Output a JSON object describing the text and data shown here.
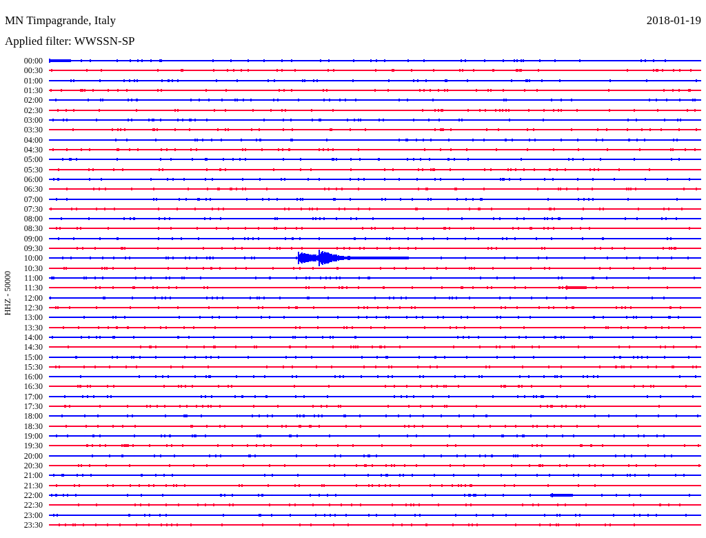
{
  "header": {
    "station": "MN Timpagrande, Italy",
    "date": "2018-01-19",
    "filter": "Applied filter: WWSSN-SP"
  },
  "axis_label": "HHZ - 50000",
  "traces": [
    {
      "time": "00:00",
      "color": "#0000ff",
      "kind": "event"
    },
    {
      "time": "00:30",
      "color": "#ff0033",
      "kind": "quiet"
    },
    {
      "time": "01:00",
      "color": "#0000ff",
      "kind": "quiet"
    },
    {
      "time": "01:30",
      "color": "#ff0033",
      "kind": "quiet"
    },
    {
      "time": "02:00",
      "color": "#0000ff",
      "kind": "quiet"
    },
    {
      "time": "02:30",
      "color": "#ff0033",
      "kind": "quiet"
    },
    {
      "time": "03:00",
      "color": "#0000ff",
      "kind": "quiet"
    },
    {
      "time": "03:30",
      "color": "#ff0033",
      "kind": "quiet"
    },
    {
      "time": "04:00",
      "color": "#0000ff",
      "kind": "quiet"
    },
    {
      "time": "04:30",
      "color": "#ff0033",
      "kind": "quiet"
    },
    {
      "time": "05:00",
      "color": "#0000ff",
      "kind": "quiet"
    },
    {
      "time": "05:30",
      "color": "#ff0033",
      "kind": "quiet"
    },
    {
      "time": "06:00",
      "color": "#0000ff",
      "kind": "quiet"
    },
    {
      "time": "06:30",
      "color": "#ff0033",
      "kind": "quiet"
    },
    {
      "time": "07:00",
      "color": "#0000ff",
      "kind": "quiet"
    },
    {
      "time": "07:30",
      "color": "#ff0033",
      "kind": "quiet"
    },
    {
      "time": "08:00",
      "color": "#0000ff",
      "kind": "quiet"
    },
    {
      "time": "08:30",
      "color": "#ff0033",
      "kind": "quiet"
    },
    {
      "time": "09:00",
      "color": "#0000ff",
      "kind": "quiet"
    },
    {
      "time": "09:30",
      "color": "#ff0033",
      "kind": "quiet"
    },
    {
      "time": "10:00",
      "color": "#0000ff",
      "kind": "quake"
    },
    {
      "time": "10:30",
      "color": "#ff0033",
      "kind": "quiet"
    },
    {
      "time": "11:00",
      "color": "#0000ff",
      "kind": "quiet"
    },
    {
      "time": "11:30",
      "color": "#ff0033",
      "kind": "event"
    },
    {
      "time": "12:00",
      "color": "#0000ff",
      "kind": "quiet"
    },
    {
      "time": "12:30",
      "color": "#ff0033",
      "kind": "quiet"
    },
    {
      "time": "13:00",
      "color": "#0000ff",
      "kind": "quiet"
    },
    {
      "time": "13:30",
      "color": "#ff0033",
      "kind": "quiet"
    },
    {
      "time": "14:00",
      "color": "#0000ff",
      "kind": "quiet"
    },
    {
      "time": "14:30",
      "color": "#ff0033",
      "kind": "quiet"
    },
    {
      "time": "15:00",
      "color": "#0000ff",
      "kind": "quiet"
    },
    {
      "time": "15:30",
      "color": "#ff0033",
      "kind": "quiet"
    },
    {
      "time": "16:00",
      "color": "#0000ff",
      "kind": "quiet"
    },
    {
      "time": "16:30",
      "color": "#ff0033",
      "kind": "quiet"
    },
    {
      "time": "17:00",
      "color": "#0000ff",
      "kind": "quiet"
    },
    {
      "time": "17:30",
      "color": "#ff0033",
      "kind": "quiet"
    },
    {
      "time": "18:00",
      "color": "#0000ff",
      "kind": "quiet"
    },
    {
      "time": "18:30",
      "color": "#ff0033",
      "kind": "quiet"
    },
    {
      "time": "19:00",
      "color": "#0000ff",
      "kind": "quiet"
    },
    {
      "time": "19:30",
      "color": "#ff0033",
      "kind": "quiet"
    },
    {
      "time": "20:00",
      "color": "#0000ff",
      "kind": "quiet"
    },
    {
      "time": "20:30",
      "color": "#ff0033",
      "kind": "quiet"
    },
    {
      "time": "21:00",
      "color": "#0000ff",
      "kind": "quiet"
    },
    {
      "time": "21:30",
      "color": "#ff0033",
      "kind": "quiet"
    },
    {
      "time": "22:00",
      "color": "#0000ff",
      "kind": "event"
    },
    {
      "time": "22:30",
      "color": "#ff0033",
      "kind": "quiet"
    },
    {
      "time": "23:00",
      "color": "#0000ff",
      "kind": "quiet"
    },
    {
      "time": "23:30",
      "color": "#ff0033",
      "kind": "quiet"
    }
  ]
}
